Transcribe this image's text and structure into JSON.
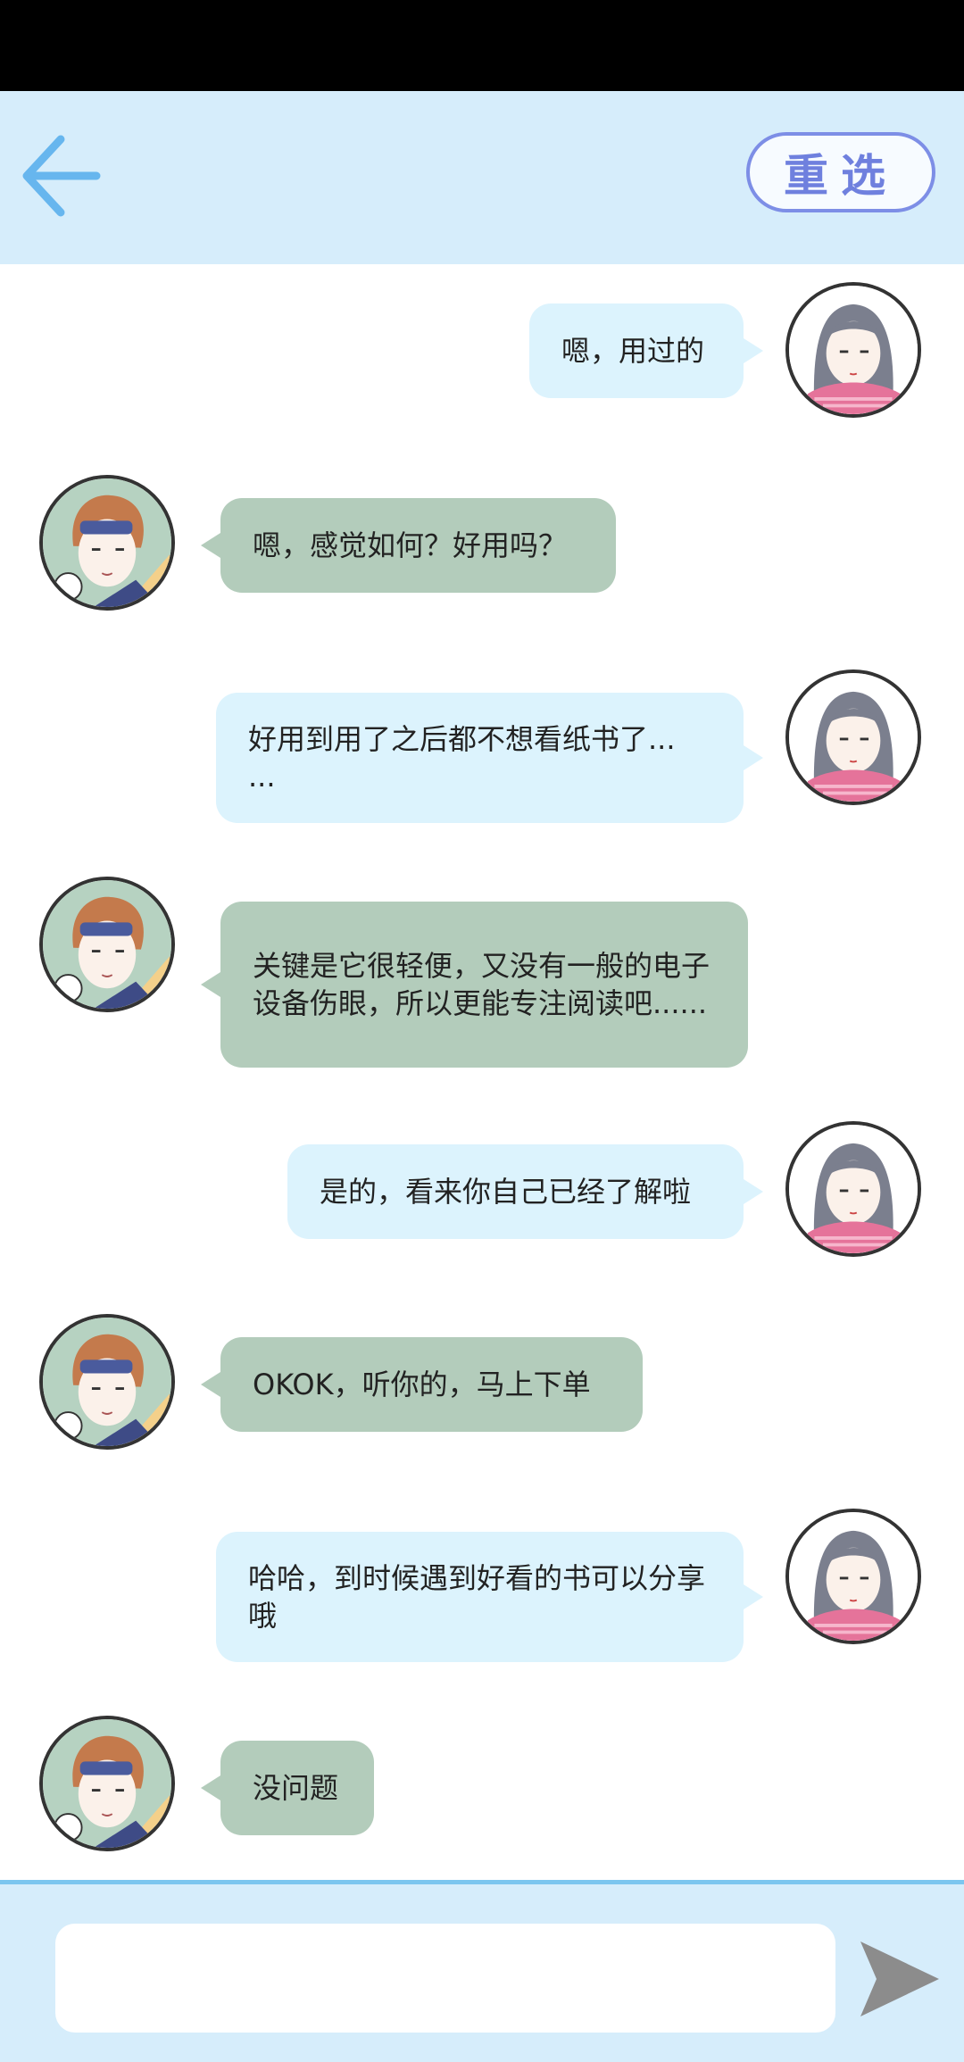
{
  "header": {
    "back_icon": "arrow-left-icon",
    "reset_label": "重选",
    "colors": {
      "background": "#d6edfb",
      "accent": "#7d8ee6",
      "back_arrow": "#67b6ee"
    }
  },
  "messages": [
    {
      "side": "right",
      "sender": "girl",
      "text": "嗯，用过的"
    },
    {
      "side": "left",
      "sender": "boy",
      "text": "嗯，感觉如何？好用吗？"
    },
    {
      "side": "right",
      "sender": "girl",
      "text": "好用到用了之后都不想看纸书了...\n..."
    },
    {
      "side": "left",
      "sender": "boy",
      "text": "关键是它很轻便，又没有一般的电子设备伤眼，所以更能专注阅读吧......"
    },
    {
      "side": "right",
      "sender": "girl",
      "text": "是的，看来你自己已经了解啦"
    },
    {
      "side": "left",
      "sender": "boy",
      "text": "OKOK，听你的，马上下单"
    },
    {
      "side": "right",
      "sender": "girl",
      "text": "哈哈，到时候遇到好看的书可以分享哦"
    },
    {
      "side": "left",
      "sender": "boy",
      "text": "没问题"
    }
  ],
  "input": {
    "value": "",
    "placeholder": ""
  },
  "send_icon": "send-arrow-icon"
}
